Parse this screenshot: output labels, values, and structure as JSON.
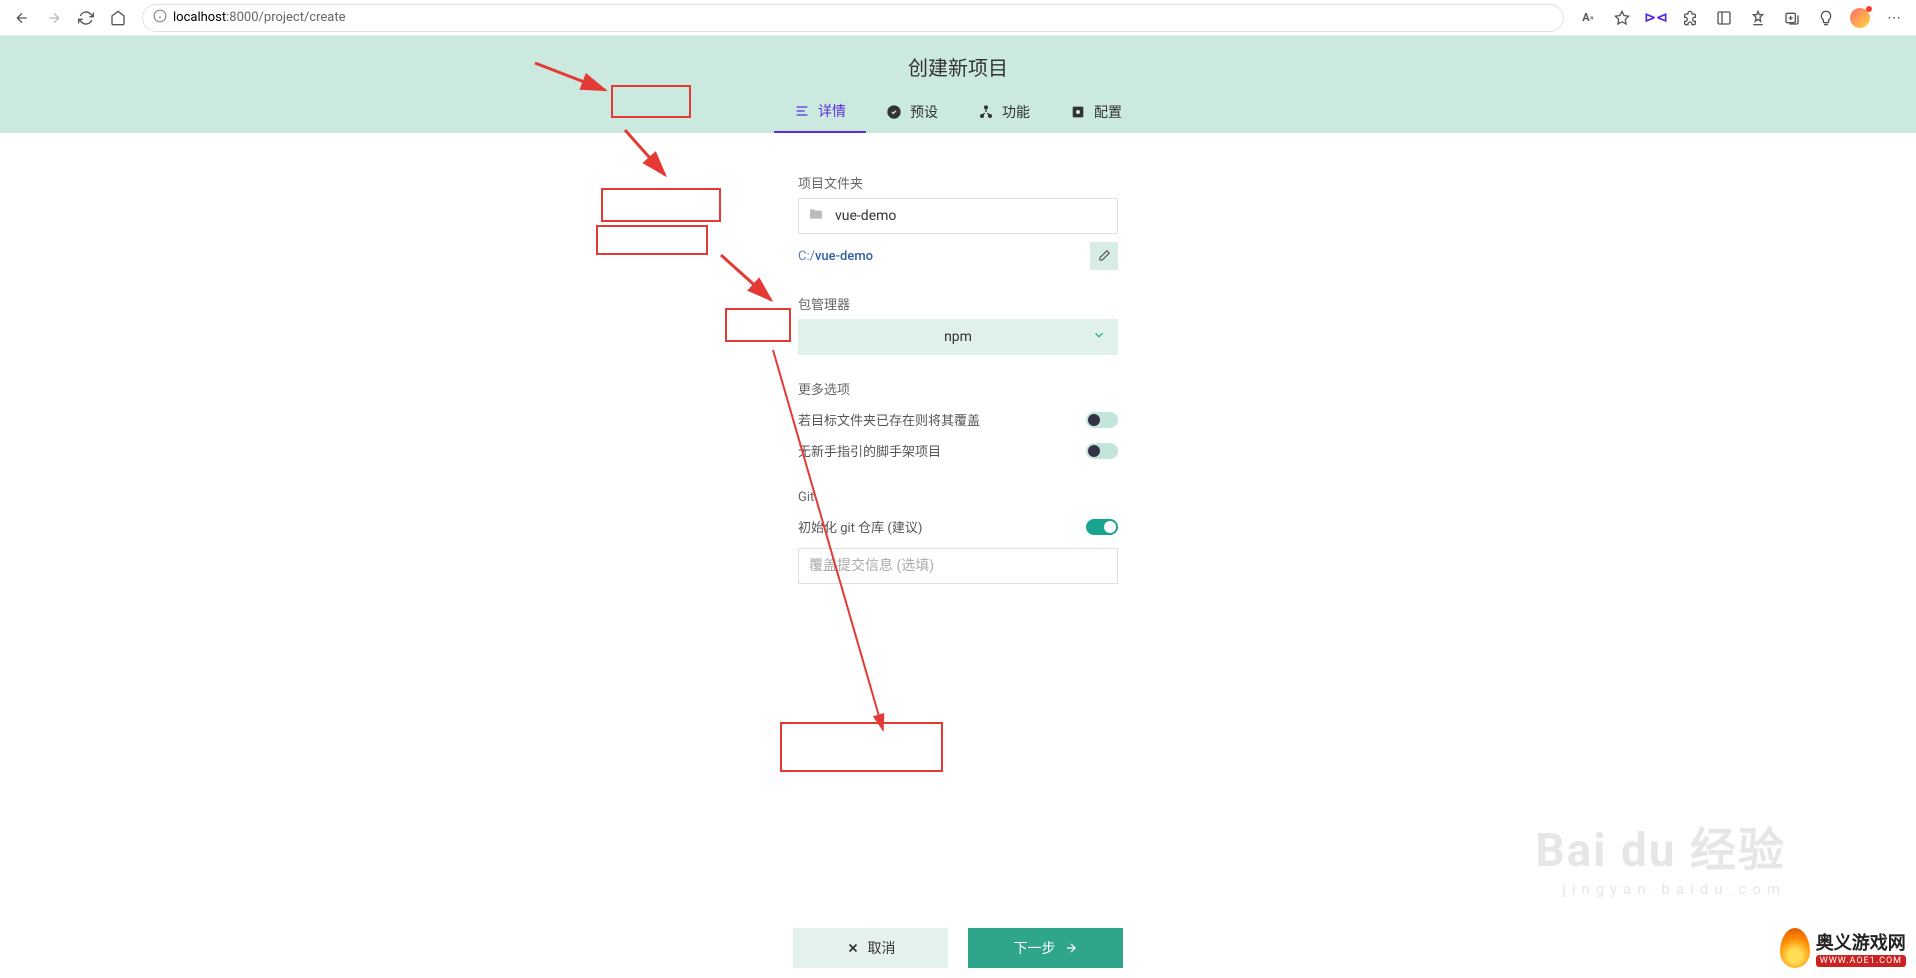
{
  "browser": {
    "url_host": "localhost",
    "url_port": ":8000",
    "url_path": "/project/create"
  },
  "header": {
    "title": "创建新项目",
    "tabs": [
      {
        "label": "详情"
      },
      {
        "label": "预设"
      },
      {
        "label": "功能"
      },
      {
        "label": "配置"
      }
    ]
  },
  "form": {
    "project_folder_label": "项目文件夹",
    "project_name": "vue-demo",
    "path_prefix": "C:/",
    "path_value": "vue-demo",
    "package_manager_label": "包管理器",
    "package_manager_value": "npm",
    "more_options_label": "更多选项",
    "overwrite_label": "若目标文件夹已存在则将其覆盖",
    "bare_label": "无新手指引的脚手架项目",
    "git_label": "Git",
    "git_init_label": "初始化 git 仓库 (建议)",
    "commit_placeholder": "覆盖提交信息 (选填)"
  },
  "buttons": {
    "cancel": "取消",
    "next": "下一步"
  },
  "watermark": {
    "baidu": "Bai du 经验",
    "baidu_sub": "jingyan.baidu.com",
    "site_cn": "奥义游戏网",
    "site_en": "WWW.AOE1.COM"
  }
}
